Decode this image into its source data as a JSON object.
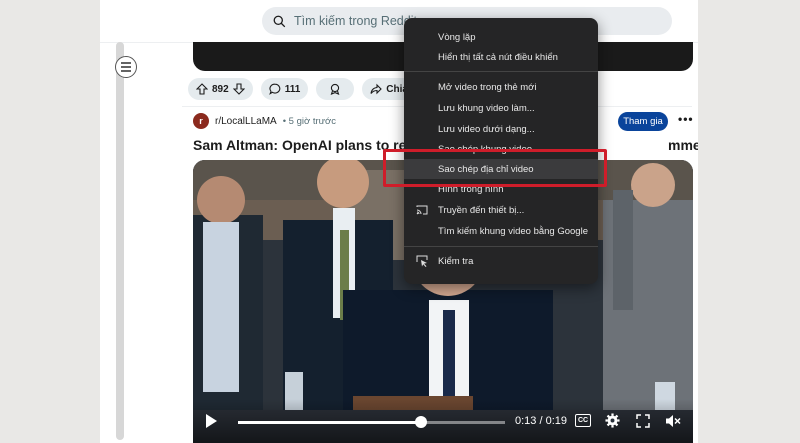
{
  "header": {
    "search_placeholder": "Tìm kiếm trong Reddit"
  },
  "actions": {
    "votes": "892",
    "comments": "111",
    "share_label": "Chia"
  },
  "post": {
    "subreddit": "r/LocalLLaMA",
    "subreddit_avatar": "r",
    "time": "• 5 giờ trước",
    "join_label": "Tham gia",
    "more_label": "•••",
    "title_start": "Sam Altman: OpenAI plans to releas",
    "title_end": "mmer"
  },
  "video": {
    "time": "0:13 / 0:19",
    "progress_fraction": 0.684,
    "cc_label": "CC"
  },
  "menu": {
    "items": [
      "Vòng lặp",
      "Hiển thị tất cả nút điều khiển",
      "Mở video trong thẻ mới",
      "Lưu khung video làm...",
      "Lưu video dưới dạng...",
      "Sao chép khung video",
      "Sao chép địa chỉ video",
      "Hình trong hình",
      "Truyền đến thiết bị...",
      "Tìm kiếm khung video bằng Google",
      "Kiểm tra"
    ],
    "highlighted_index": 6
  },
  "colors": {
    "accent": "#0a449b",
    "highlight_border": "#cf1d2a",
    "menu_bg": "#252526"
  }
}
